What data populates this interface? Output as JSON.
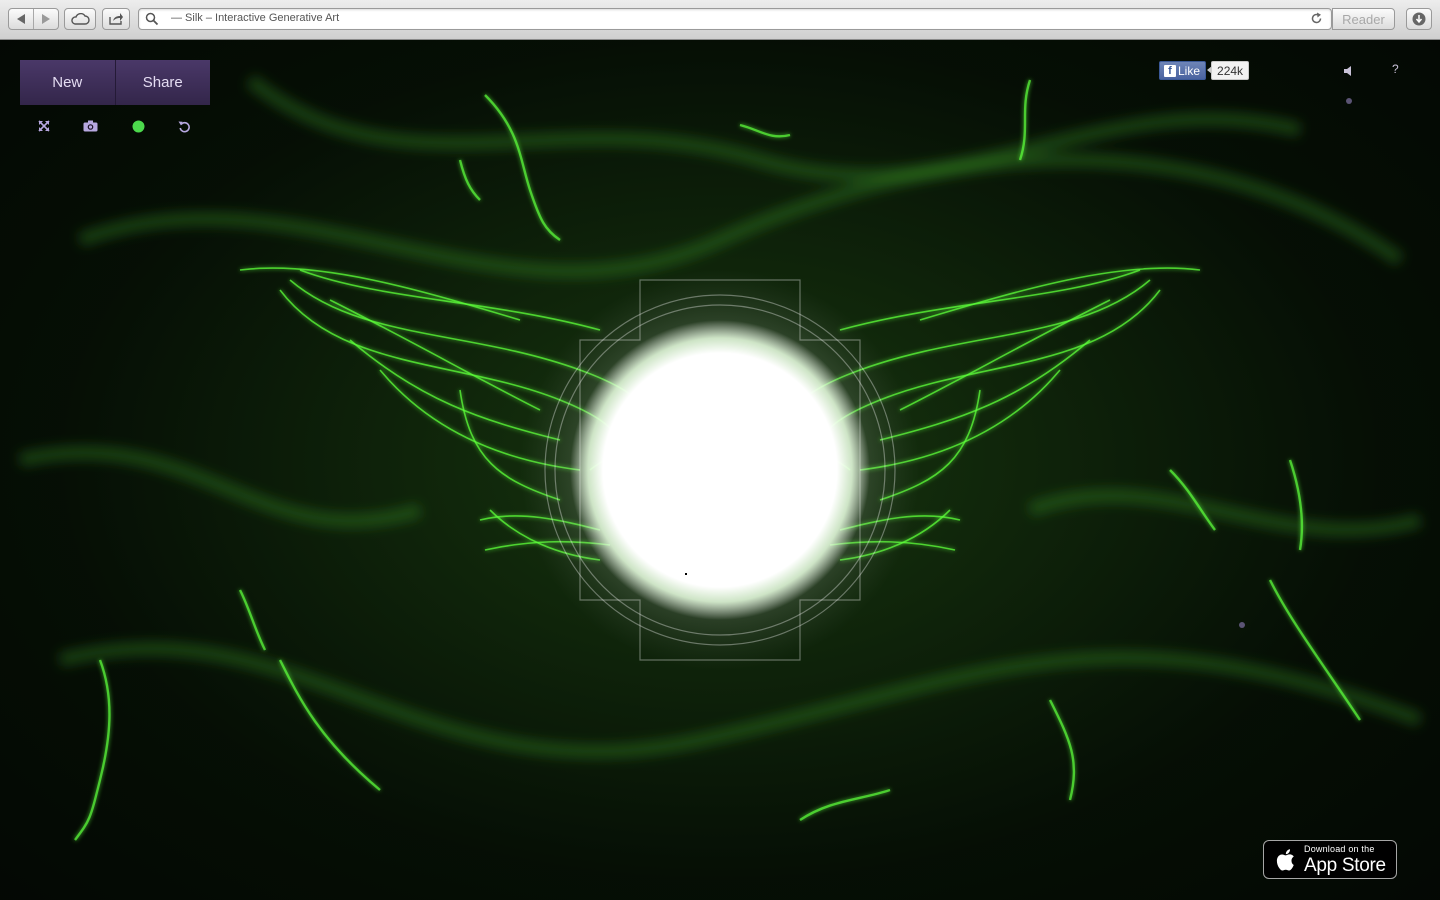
{
  "browser": {
    "address_title": "— Silk – Interactive Generative Art",
    "reader_label": "Reader"
  },
  "toolbar": {
    "new_label": "New",
    "share_label": "Share",
    "tools": [
      "fullscreen-icon",
      "camera-icon",
      "color-dot-icon",
      "undo-icon"
    ],
    "selected_color": "#4cd94c"
  },
  "social": {
    "like_label": "Like",
    "like_count": "224k"
  },
  "controls": {
    "help_label": "?"
  },
  "appstore": {
    "small_text": "Download on the",
    "big_text": "App Store"
  },
  "colors": {
    "silk": "#5cff3a",
    "button_bg": "#3a2b54",
    "center_glow": "#ffffff"
  }
}
